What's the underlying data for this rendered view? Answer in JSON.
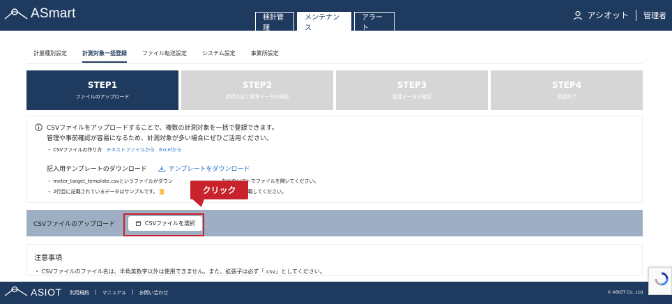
{
  "header": {
    "brand": "ASmart",
    "tabs": [
      {
        "label": "検針管理",
        "active": false
      },
      {
        "label": "メンテナンス",
        "active": true
      },
      {
        "label": "アラート",
        "active": false
      }
    ],
    "user_name": "アシオット",
    "user_role": "管理者"
  },
  "subnav": {
    "items": [
      {
        "label": "計量種別設定",
        "active": false
      },
      {
        "label": "計測対象一括登録",
        "active": true
      },
      {
        "label": "ファイル転送設定",
        "active": false
      },
      {
        "label": "システム設定",
        "active": false
      },
      {
        "label": "事業所設定",
        "active": false
      }
    ]
  },
  "steps": [
    {
      "title": "STEP1",
      "desc": "ファイルのアップロード",
      "active": true
    },
    {
      "title": "STEP2",
      "desc": "登録方式と異常データの確認",
      "active": false
    },
    {
      "title": "STEP3",
      "desc": "登録データの確認",
      "active": false
    },
    {
      "title": "STEP4",
      "desc": "登録完了",
      "active": false
    }
  ],
  "info": {
    "line1": "CSVファイルをアップロードすることで、複数の計測対象を一括で登録できます。",
    "line2": "管理や事前確認が容易になるため、計測対象が多い場合にぜひご活用ください。",
    "howto_label": "・ CSVファイルの作り方",
    "howto_link1": "テキストファイルから",
    "howto_link2": "Excelから",
    "template_label": "記入用テンプレートのダウンロード",
    "template_link": "テンプレートをダウンロード",
    "note1": "・ meter_target_template.csvというファイルがダウン",
    "note1_tail": "などのソフトでファイルを開いてください。",
    "note2": "・ 2行目に記載されているデータはサンプルです。",
    "note2_tail": "し、データを記載してください。"
  },
  "upload": {
    "label": "CSVファイルのアップロード",
    "button": "CSVファイルを選択"
  },
  "callout": "クリック",
  "precaution": {
    "heading": "注意事項",
    "text": "・ CSVファイルのファイル名は、半角英数字以外は使用できません。また、拡張子は必ず「.csv」としてください。"
  },
  "footer": {
    "brand": "ASIOT",
    "links": [
      "利用規約",
      "マニュアル",
      "お問い合わせ"
    ],
    "copyright": "© ASIOT Co., Ltd."
  },
  "colors": {
    "navy": "#1f3a5f",
    "step_inactive": "#d6d6d6",
    "upload_bar": "#9eafc4",
    "highlight_red": "#c8232c",
    "link_blue": "#2b72c9"
  }
}
